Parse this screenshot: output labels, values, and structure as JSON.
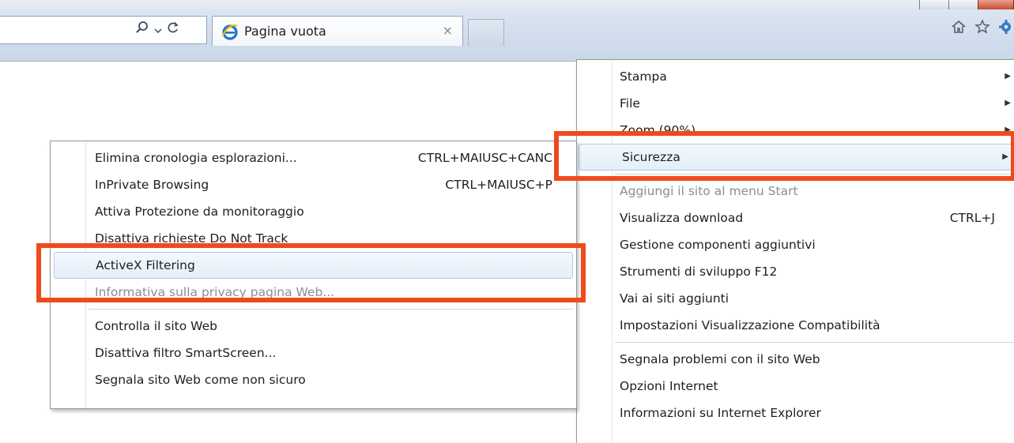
{
  "browser": {
    "tab_title": "Pagina vuota",
    "tab_close": "×",
    "search_icon": "search-icon",
    "dropdown_icon": "chevron-down-icon",
    "refresh_icon": "refresh-icon",
    "toolbar_icons": [
      "home-icon",
      "star-icon",
      "gear-icon"
    ]
  },
  "tools_menu": {
    "items": [
      {
        "label": "Stampa",
        "submenu": true
      },
      {
        "label": "File",
        "submenu": true
      },
      {
        "label": "Zoom (90%)",
        "submenu": true
      },
      {
        "label": "Sicurezza",
        "submenu": true,
        "highlighted": true
      },
      {
        "label": "Aggiungi il sito al menu Start",
        "disabled": true
      },
      {
        "label": "Visualizza download",
        "shortcut": "CTRL+J"
      },
      {
        "label": "Gestione componenti aggiuntivi"
      },
      {
        "label": "Strumenti di sviluppo F12"
      },
      {
        "label": "Vai ai siti aggiunti"
      },
      {
        "label": "Impostazioni Visualizzazione Compatibilità"
      },
      {
        "label": "Segnala problemi con il sito Web"
      },
      {
        "label": "Opzioni Internet"
      },
      {
        "label": "Informazioni su Internet Explorer"
      }
    ]
  },
  "security_submenu": {
    "items": [
      {
        "label": "Elimina cronologia esplorazioni...",
        "shortcut": "CTRL+MAIUSC+CANC"
      },
      {
        "label": "InPrivate Browsing",
        "shortcut": "CTRL+MAIUSC+P"
      },
      {
        "label": "Attiva Protezione da monitoraggio"
      },
      {
        "label": "Disattiva richieste Do Not Track"
      },
      {
        "label": "ActiveX Filtering",
        "highlighted": true
      },
      {
        "label": "Informativa sulla privacy pagina Web...",
        "disabled": true
      },
      {
        "label": "Controlla il sito Web"
      },
      {
        "label": "Disattiva filtro SmartScreen..."
      },
      {
        "label": "Segnala sito Web come non sicuro"
      }
    ]
  },
  "colors": {
    "highlight_border": "#ef4a1c",
    "menu_hover": "#e4eefa",
    "chrome": "#d2deec"
  }
}
